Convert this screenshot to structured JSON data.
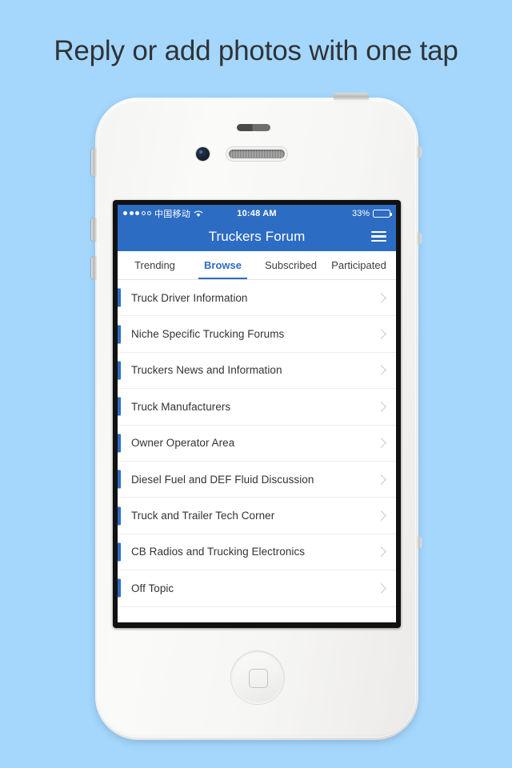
{
  "headline": "Reply or add photos with one tap",
  "colors": {
    "background": "#a5d7fd",
    "brand_blue": "#2d6cc3",
    "headline_text": "#2f3336",
    "row_text": "#333333",
    "chevron": "#c9c9c9"
  },
  "status_bar": {
    "signal_dots_filled": 3,
    "signal_dots_total": 5,
    "carrier": "中国移动",
    "wifi": "wifi-icon",
    "time": "10:48 AM",
    "battery_percent": "33%",
    "battery_level": 33
  },
  "nav": {
    "title": "Truckers Forum",
    "menu_icon": "hamburger-menu-icon"
  },
  "tabs": [
    {
      "label": "Trending",
      "active": false
    },
    {
      "label": "Browse",
      "active": true
    },
    {
      "label": "Subscribed",
      "active": false
    },
    {
      "label": "Participated",
      "active": false
    }
  ],
  "list": {
    "items": [
      {
        "label": "Truck Driver Information"
      },
      {
        "label": "Niche Specific Trucking Forums"
      },
      {
        "label": "Truckers News and Information"
      },
      {
        "label": "Truck Manufacturers"
      },
      {
        "label": "Owner Operator Area"
      },
      {
        "label": "Diesel Fuel and DEF Fluid Discussion"
      },
      {
        "label": "Truck and Trailer Tech Corner"
      },
      {
        "label": "CB Radios and Trucking Electronics"
      },
      {
        "label": "Off Topic"
      }
    ]
  },
  "device": {
    "home_button": "home-button",
    "front_camera": "front-camera",
    "earpiece": "earpiece-speaker",
    "power_button": "power-button",
    "mute_switch": "mute-switch",
    "volume_up": "volume-up-button",
    "volume_down": "volume-down-button"
  }
}
